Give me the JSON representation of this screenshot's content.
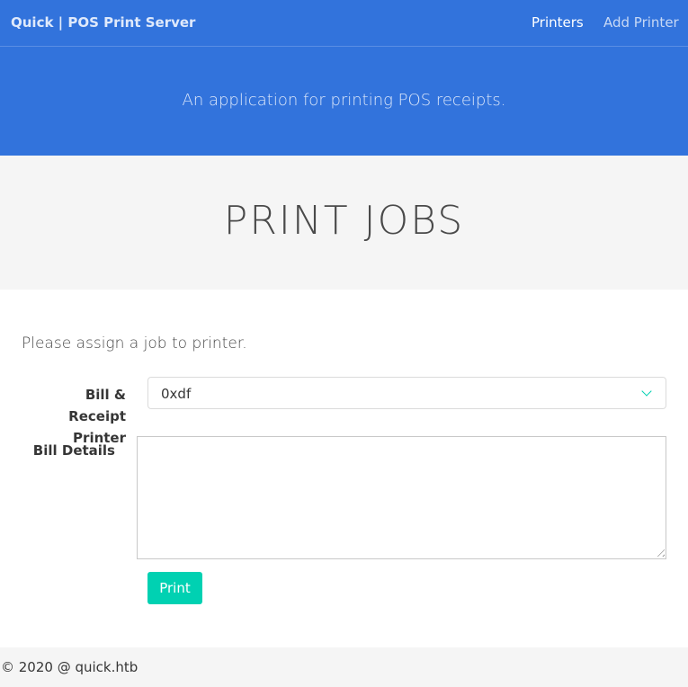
{
  "navbar": {
    "brand": "Quick | POS Print Server",
    "links": [
      {
        "label": "Printers"
      },
      {
        "label": "Add Printer"
      }
    ]
  },
  "hero": {
    "subtitle": "An application for printing POS receipts."
  },
  "page": {
    "title": "PRINT JOBS"
  },
  "form": {
    "intro": "Please assign a job to printer.",
    "printer_label": "Bill & Receipt Printer",
    "printer_selected": "0xdf",
    "details_label": "Bill Details",
    "details_value": "",
    "submit_label": "Print"
  },
  "footer": {
    "text": "© 2020 @ quick.htb"
  },
  "colors": {
    "primary": "#3273dc",
    "accent": "#00d1b2",
    "light_band": "#f5f5f5"
  }
}
